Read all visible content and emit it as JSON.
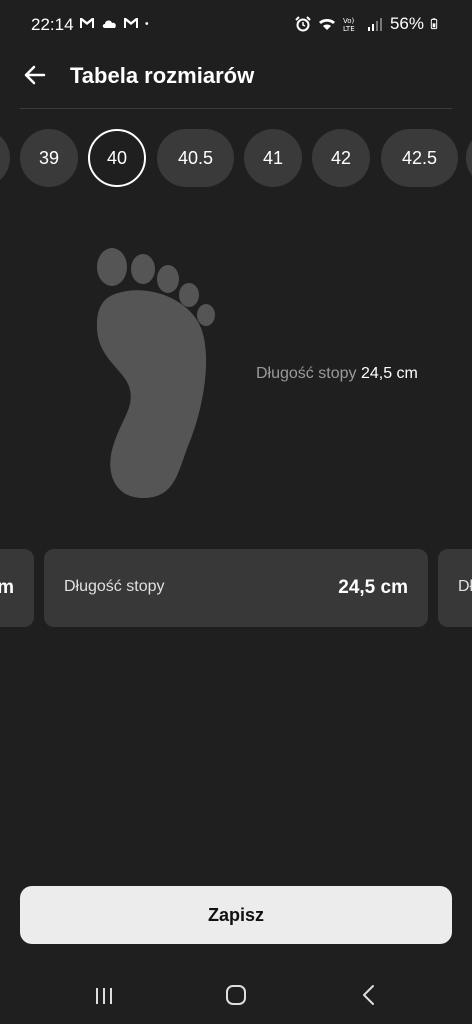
{
  "status_bar": {
    "time": "22:14",
    "battery": "56%",
    "notification_icons": [
      "gmail-icon",
      "cloud-icon",
      "gmail-icon",
      "dot-icon"
    ],
    "system_icons": [
      "alarm-icon",
      "wifi-icon",
      "volte-icon",
      "signal-icon",
      "battery-icon"
    ]
  },
  "header": {
    "title": "Tabela rozmiarów",
    "back_icon": "arrow-left-icon"
  },
  "sizes": {
    "items": [
      "39",
      "40",
      "40.5",
      "41",
      "42",
      "42.5"
    ],
    "selected": "40"
  },
  "foot": {
    "label": "Długość stopy",
    "value": "24,5 cm"
  },
  "cards": {
    "left_fragment": "m",
    "main_label": "Długość stopy",
    "main_value": "24,5 cm",
    "right_fragment": "Dł"
  },
  "save_button": {
    "label": "Zapisz"
  },
  "nav_bar": {
    "icons": [
      "recents-icon",
      "home-icon",
      "back-icon"
    ]
  },
  "colors": {
    "background": "#1f1f1f",
    "chip": "#3a3a3a",
    "card": "#383838",
    "foot": "#555555",
    "button": "#ececec"
  }
}
